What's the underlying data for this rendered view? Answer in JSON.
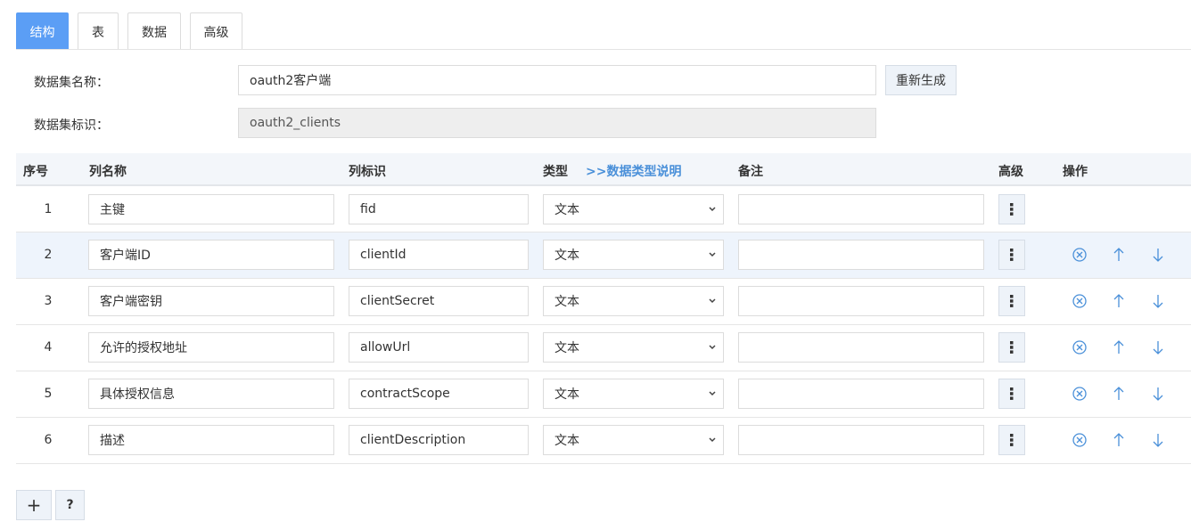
{
  "tabs": [
    {
      "label": "结构",
      "active": true
    },
    {
      "label": "表",
      "active": false
    },
    {
      "label": "数据",
      "active": false
    },
    {
      "label": "高级",
      "active": false
    }
  ],
  "form": {
    "name_label": "数据集名称：",
    "name_value": "oauth2客户端",
    "id_label": "数据集标识：",
    "id_value": "oauth2_clients",
    "regenerate_label": "重新生成"
  },
  "table": {
    "headers": {
      "index": "序号",
      "col_name": "列名称",
      "col_id": "列标识",
      "type": "类型",
      "type_link": ">>数据类型说明",
      "remark": "备注",
      "advanced": "高级",
      "actions": "操作"
    },
    "rows": [
      {
        "index": "1",
        "name": "主键",
        "id": "fid",
        "type": "文本",
        "remark": ""
      },
      {
        "index": "2",
        "name": "客户端ID",
        "id": "clientId",
        "type": "文本",
        "remark": ""
      },
      {
        "index": "3",
        "name": "客户端密钥",
        "id": "clientSecret",
        "type": "文本",
        "remark": ""
      },
      {
        "index": "4",
        "name": "允许的授权地址",
        "id": "allowUrl",
        "type": "文本",
        "remark": ""
      },
      {
        "index": "5",
        "name": "具体授权信息",
        "id": "contractScope",
        "type": "文本",
        "remark": ""
      },
      {
        "index": "6",
        "name": "描述",
        "id": "clientDescription",
        "type": "文本",
        "remark": ""
      }
    ]
  },
  "footer": {
    "add_label": "+",
    "help_label": "?"
  },
  "colors": {
    "accent": "#5b9ef5",
    "link": "#4a90d9",
    "icon": "#4a90d9",
    "row_highlight": "#eef4fc"
  }
}
